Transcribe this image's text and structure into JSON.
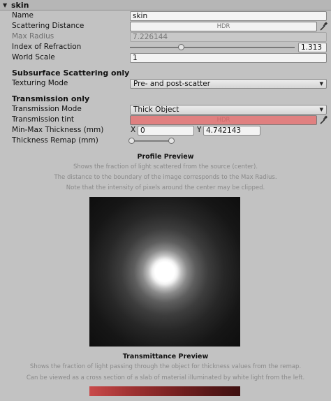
{
  "header": {
    "title": "skin"
  },
  "name": {
    "label": "Name",
    "value": "skin"
  },
  "scattering_distance": {
    "label": "Scattering Distance",
    "badge": "HDR",
    "color": "#f2f2f2"
  },
  "max_radius": {
    "label": "Max Radius",
    "value": "7.226144"
  },
  "index_of_refraction": {
    "label": "Index of Refraction",
    "value": "1.313",
    "slider_fraction": 0.313
  },
  "world_scale": {
    "label": "World Scale",
    "value": "1"
  },
  "sss_section": {
    "title": "Subsurface Scattering only"
  },
  "texturing_mode": {
    "label": "Texturing Mode",
    "value": "Pre- and post-scatter"
  },
  "transmission_section": {
    "title": "Transmission only"
  },
  "transmission_mode": {
    "label": "Transmission Mode",
    "value": "Thick Object"
  },
  "transmission_tint": {
    "label": "Transmission tint",
    "badge": "HDR",
    "color": "#e08080"
  },
  "min_max_thickness": {
    "label": "Min-Max Thickness (mm)",
    "x_label": "X",
    "x_value": "0",
    "y_label": "Y",
    "y_value": "4.742143"
  },
  "thickness_remap": {
    "label": "Thickness Remap (mm)"
  },
  "profile_preview": {
    "title": "Profile Preview",
    "desc": [
      "Shows the fraction of light scattered from the source (center).",
      "The distance to the boundary of the image corresponds to the Max Radius.",
      "Note that the intensity of pixels around the center may be clipped."
    ]
  },
  "transmittance_preview": {
    "title": "Transmittance Preview",
    "desc": [
      "Shows the fraction of light passing through the object for thickness values from the remap.",
      "Can be viewed as a cross section of a slab of material illuminated by white light from the left."
    ]
  },
  "icons": {
    "foldout": "triangle-down-icon",
    "eyedropper": "eyedropper-icon",
    "dropdown": "dropdown-arrow-icon"
  }
}
